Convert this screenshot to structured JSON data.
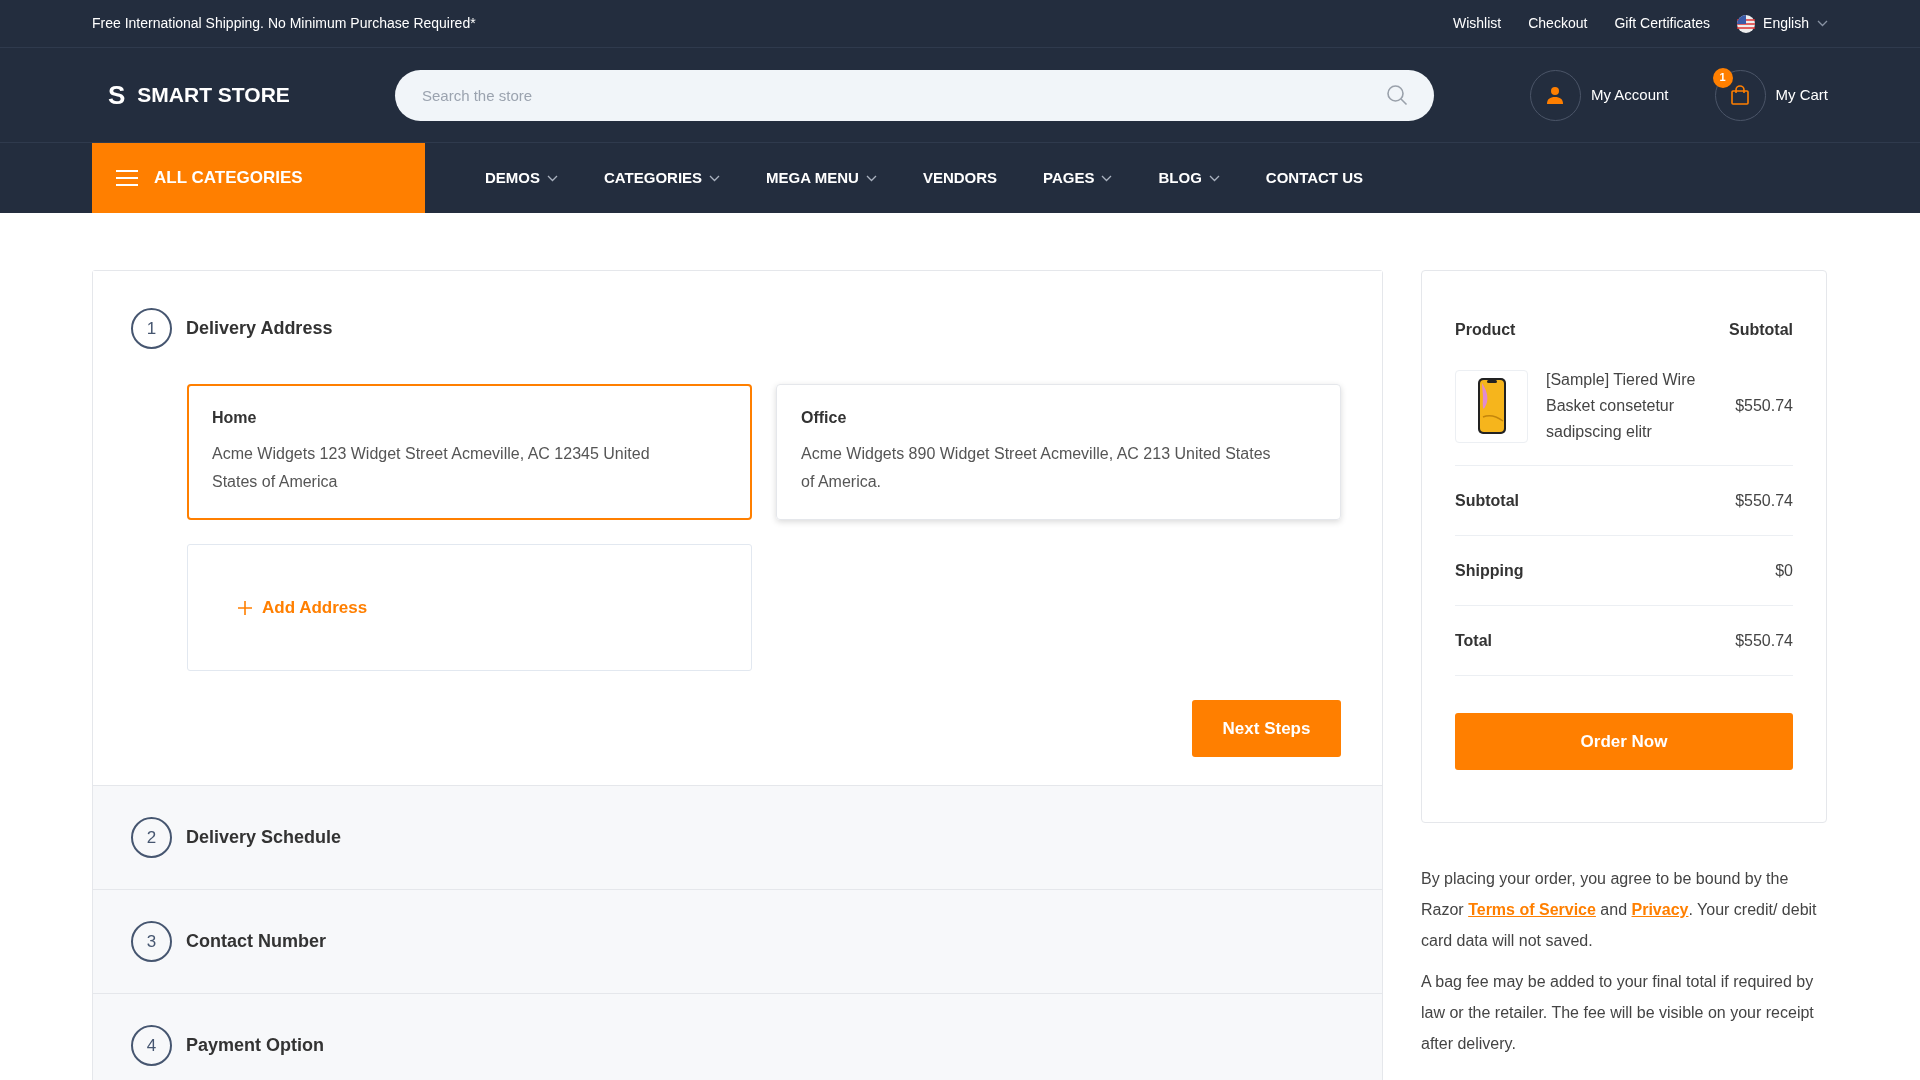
{
  "top_bar": {
    "promo": "Free International Shipping. No Minimum Purchase Required*",
    "links": [
      "Wishlist",
      "Checkout",
      "Gift Certificates"
    ],
    "language": "English"
  },
  "header": {
    "logo_mark": "S",
    "logo_text": "SMART STORE",
    "search": {
      "placeholder": "Search the store"
    },
    "account": "My Account",
    "cart": {
      "label": "My Cart",
      "count": "1"
    }
  },
  "nav": {
    "all_categories": "ALL CATEGORIES",
    "items": [
      {
        "label": "DEMOS",
        "dropdown": true
      },
      {
        "label": "CATEGORIES",
        "dropdown": true
      },
      {
        "label": "MEGA MENU",
        "dropdown": true
      },
      {
        "label": "VENDORS",
        "dropdown": false
      },
      {
        "label": "PAGES",
        "dropdown": true
      },
      {
        "label": "BLOG",
        "dropdown": true
      },
      {
        "label": "CONTACT US",
        "dropdown": false
      }
    ]
  },
  "steps": [
    {
      "number": "1",
      "title": "Delivery Address",
      "expanded": true
    },
    {
      "number": "2",
      "title": "Delivery Schedule",
      "expanded": false
    },
    {
      "number": "3",
      "title": "Contact Number",
      "expanded": false
    },
    {
      "number": "4",
      "title": "Payment Option",
      "expanded": false
    }
  ],
  "addresses": [
    {
      "title": "Home",
      "text": "Acme Widgets 123 Widget Street Acmeville, AC 12345 United States of America",
      "selected": true
    },
    {
      "title": "Office",
      "text": "Acme Widgets 890 Widget Street Acmeville, AC 213 United States of America.",
      "selected": false
    }
  ],
  "add_address": "Add Address",
  "next_button": "Next Steps",
  "summary": {
    "product_heading": "Product",
    "subtotal_heading": "Subtotal",
    "items": [
      {
        "name": "[Sample] Tiered Wire Basket consetetur sadipscing elitr",
        "price": "$550.74"
      }
    ],
    "rows": [
      {
        "label": "Subtotal",
        "value": "$550.74"
      },
      {
        "label": "Shipping",
        "value": "$0"
      },
      {
        "label": "Total",
        "value": "$550.74"
      }
    ],
    "order_button": "Order Now"
  },
  "notice": {
    "before": "By placing your order, you agree to be bound by the Razor",
    "terms_link": "Terms of Service",
    "middle": "and",
    "privacy_link": "Privacy",
    "after": ". Your credit/ debit card data will not saved."
  },
  "bag_fee": "A bag fee may be added to your final total if required by law or the retailer. The fee will be visible on your receipt after delivery."
}
